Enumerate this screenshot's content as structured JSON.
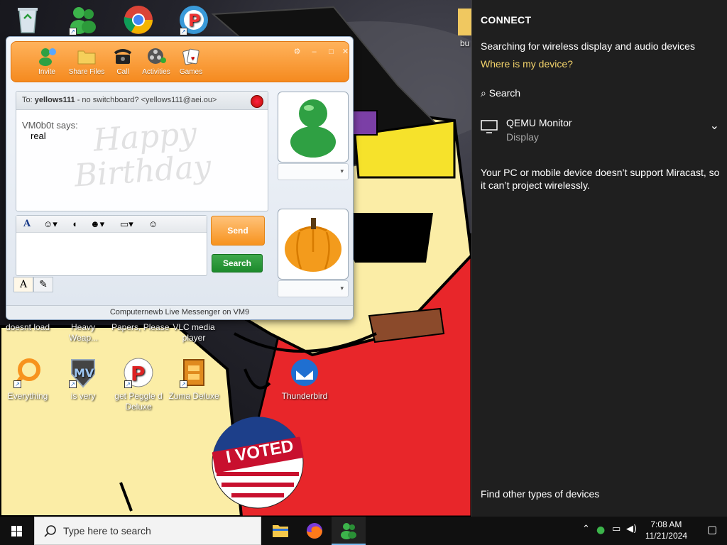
{
  "desktop": {
    "icons_top": [
      {
        "label": "Recycle Bin"
      },
      {
        "label": "Windows Live Messenger"
      },
      {
        "label": "Google Chrome"
      },
      {
        "label": "Peggle"
      }
    ],
    "icons_mid": [
      {
        "label": "doesnt load"
      },
      {
        "label": "Heavy Weap..."
      },
      {
        "label": "Papers, Please"
      },
      {
        "label": "VLC media player"
      }
    ],
    "icons_bottom": [
      {
        "label": "Everything"
      },
      {
        "label": "is very"
      },
      {
        "label": "get Peggle d Deluxe"
      },
      {
        "label": "Zuma Deluxe"
      },
      {
        "label": "Thunderbird"
      }
    ],
    "folder_label": "bu",
    "sticker_text": "I VOTED"
  },
  "messenger": {
    "toolbar": [
      {
        "label": "Invite"
      },
      {
        "label": "Share Files"
      },
      {
        "label": "Call"
      },
      {
        "label": "Activities"
      },
      {
        "label": "Games"
      }
    ],
    "to_prefix": "To:",
    "to_name": "yellows111",
    "to_detail": "- no switchboard? <yellows111@aei.ou>",
    "background_text_1": "Happy",
    "background_text_2": "Birthday",
    "sender": "VM0b0t says:",
    "message": "real",
    "send_label": "Send",
    "search_label": "Search",
    "status_text": "Computernewb Live Messenger on VM9",
    "accent_orange": "#f58a1f",
    "accent_green": "#1c8a2c"
  },
  "connect": {
    "title": "CONNECT",
    "searching": "Searching for wireless display and audio devices",
    "where_link": "Where is my device?",
    "search_label": "Search",
    "device_name": "QEMU Monitor",
    "device_type": "Display",
    "message": "Your PC or mobile device doesn’t support Miracast, so it can’t project wirelessly.",
    "other_link": "Find other types of devices",
    "link_color": "#f3d36b"
  },
  "taskbar": {
    "search_placeholder": "Type here to search",
    "time": "7:08 AM",
    "date": "11/21/2024"
  }
}
